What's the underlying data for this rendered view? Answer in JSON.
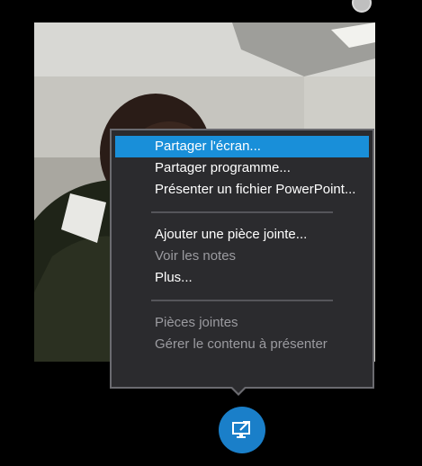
{
  "menu": {
    "items": [
      {
        "label": "Partager l'écran...",
        "state": "selected"
      },
      {
        "label": "Partager programme...",
        "state": "normal"
      },
      {
        "label": "Présenter un fichier PowerPoint...",
        "state": "normal"
      },
      {
        "label": "Ajouter une pièce jointe...",
        "state": "normal"
      },
      {
        "label": "Voir les notes",
        "state": "disabled"
      },
      {
        "label": "Plus...",
        "state": "normal"
      },
      {
        "label": "Pièces jointes",
        "state": "disabled"
      },
      {
        "label": "Gérer le contenu à présenter",
        "state": "disabled"
      }
    ]
  },
  "share_button": {
    "icon": "present-screen-icon"
  },
  "colors": {
    "accent": "#198fd9",
    "menu_bg": "#2b2b2e",
    "menu_border": "#6b6b70",
    "button_bg": "#1a7fc9"
  }
}
